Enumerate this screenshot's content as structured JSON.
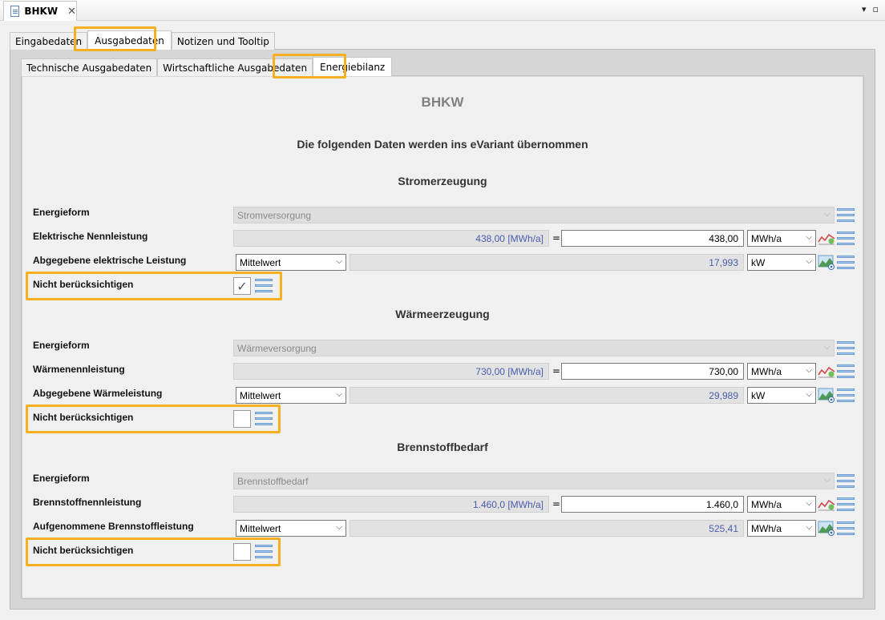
{
  "editor": {
    "tab_title": "BHKW",
    "close_glyph": "✕",
    "controls": [
      "▾",
      "▫"
    ]
  },
  "tabs": {
    "outer": [
      "Eingabedaten",
      "Ausgabedaten",
      "Notizen und Tooltip"
    ],
    "inner": [
      "Technische Ausgabedaten",
      "Wirtschaftliche Ausgabedaten",
      "Energiebilanz"
    ]
  },
  "content": {
    "title": "BHKW",
    "subtitle": "Die folgenden Daten werden ins eVariant übernommen"
  },
  "common": {
    "eq": "=",
    "nicht_label": "Nicht berücksichtigen",
    "energieform_label": "Energieform",
    "checkmark": "✓",
    "chevron": "⌵"
  },
  "strom": {
    "heading": "Stromerzeugung",
    "energieform_value": "Stromversorgung",
    "nenn_label": "Elektrische Nennleistung",
    "nenn_readonly": "438,00 [MWh/a]",
    "nenn_input": "438,00",
    "nenn_unit": "MWh/a",
    "abg_label": "Abgegebene elektrische Leistung",
    "abg_mode": "Mittelwert",
    "abg_value": "17,993",
    "abg_unit": "kW",
    "checked": true
  },
  "waerme": {
    "heading": "Wärmeerzeugung",
    "energieform_value": "Wärmeversorgung",
    "nenn_label": "Wärmenennleistung",
    "nenn_readonly": "730,00 [MWh/a]",
    "nenn_input": "730,00",
    "nenn_unit": "MWh/a",
    "abg_label": "Abgegebene Wärmeleistung",
    "abg_mode": "Mittelwert",
    "abg_value": "29,989",
    "abg_unit": "kW",
    "checked": false
  },
  "brenn": {
    "heading": "Brennstoffbedarf",
    "energieform_value": "Brennstoffbedarf",
    "nenn_label": "Brennstoffnennleistung",
    "nenn_readonly": "1.460,0 [MWh/a]",
    "nenn_input": "1.460,0",
    "nenn_unit": "MWh/a",
    "abg_label": "Aufgenommene Brennstoffleistung",
    "abg_mode": "Mittelwert",
    "abg_value": "525,41",
    "abg_unit": "MWh/a",
    "checked": false
  },
  "colors": {
    "highlight": "#f5b021",
    "value_text": "#4a5dad",
    "list_icon": "#a8c8ec"
  }
}
